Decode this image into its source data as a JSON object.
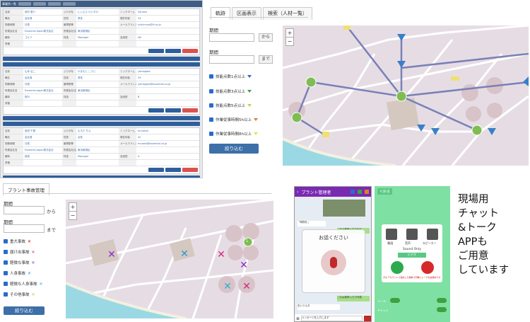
{
  "top_left": {
    "header": "事業所一覧",
    "cards": [
      {
        "rows": [
          [
            "名前",
            "西村 恵介",
            "ふりがな",
            "にしむら けいすけ",
            "ニックネーム",
            "Sanaza"
          ],
          [
            "職名",
            "会社員",
            "性別",
            "男性",
            "現在年齢",
            "34"
          ],
          [
            "勤務時間",
            "日勤",
            "最寄駅等",
            "",
            "メールアドレス",
            "nishimura@fr.co.jp"
          ],
          [
            "所属会社名",
            "Essential Japan株式会社",
            "所属会社住所",
            "東京都港区",
            "",
            ""
          ],
          [
            "趣味",
            "ゴルフ",
            "特技",
            "Manager",
            "血液型",
            "AB"
          ],
          [
            "資格",
            "",
            "",
            "",
            "",
            ""
          ]
        ]
      },
      {
        "rows": [
          [
            "名前",
            "山本 弘二",
            "ふりがな",
            "やまもと こうじ",
            "ニックネーム",
            "yamagata"
          ],
          [
            "職名",
            "会社員",
            "性別",
            "男性",
            "現在年齢",
            "39"
          ],
          [
            "勤務時間",
            "日勤",
            "最寄駅等",
            "",
            "メールアドレス",
            "yamagata@essential.co.jp"
          ],
          [
            "所属会社名",
            "Essential Japan株式会社",
            "所属会社住所",
            "東京都港区",
            "",
            ""
          ],
          [
            "趣味",
            "旅行",
            "特技",
            "",
            "血液型",
            "B"
          ],
          [
            "資格",
            "",
            "",
            "",
            "",
            ""
          ]
        ]
      },
      {
        "rows": [
          [
            "名前",
            "室田 千恵",
            "ふりがな",
            "むろた ちえ",
            "ニックネーム",
            "murotae"
          ],
          [
            "職名",
            "会社員",
            "性別",
            "女性",
            "現在年齢",
            "42"
          ],
          [
            "勤務時間",
            "日勤",
            "最寄駅等",
            "",
            "メールアドレス",
            "murota@essential.co.jp"
          ],
          [
            "所属会社名",
            "Essential Japan株式会社",
            "所属会社住所",
            "東京都港区",
            "",
            ""
          ],
          [
            "趣味",
            "読書",
            "特技",
            "Manager",
            "血液型",
            "A"
          ],
          [
            "資格",
            "",
            "",
            "",
            "",
            ""
          ]
        ]
      }
    ]
  },
  "top_right": {
    "tabs": [
      "軌跡",
      "区画表示",
      "検索（人材一覧）"
    ],
    "period_label": "期間",
    "from_suffix": "から",
    "to_suffix": "まで",
    "filters": [
      {
        "label": "技能点数1点以上",
        "color": "#2a6ad0"
      },
      {
        "label": "技能点数3点以上",
        "color": "#3fa03f"
      },
      {
        "label": "技能点数5点以上",
        "color": "#c8d43a"
      },
      {
        "label": "作業従事時間5h以上",
        "color": "#e07b2a"
      },
      {
        "label": "作業従事時間8h以上",
        "color": "#e8e23a"
      }
    ],
    "submit": "絞り込む",
    "markers": [
      "14",
      "2",
      "2",
      "2",
      "3",
      "1",
      "14"
    ],
    "zoom": [
      "+",
      "−"
    ]
  },
  "bottom_left": {
    "tab": "プラント事故管理",
    "period_label": "期間",
    "from_suffix": "から",
    "to_suffix": "まで",
    "filters": [
      "重大事故",
      "届け出事故",
      "軽微な事故",
      "人身事故",
      "軽微な人身事故",
      "その他事故"
    ],
    "submit": "絞り込む",
    "marker": "1",
    "zoom": [
      "+",
      "−"
    ]
  },
  "phone_chat": {
    "title": "プラント管理者",
    "voice_prompt": "お話ください",
    "chat_lines": [
      "「荷物を」",
      "これは音声入力された",
      "これは音声入力で作成",
      "あいうえお"
    ],
    "input_placeholder": "メッセージを入力します"
  },
  "phone_call": {
    "back": "＜戻る",
    "options": [
      "動画",
      "音声",
      "スピーカー"
    ],
    "sound_only": "Sound Only",
    "toggle_label": "ビデオ",
    "warning": "同じアカウントで接続した端末で同時にトークを実施中です",
    "bottom_labels": [
      "メール",
      "チャット"
    ]
  },
  "caption": [
    "現場用",
    "チャット",
    "&トーク",
    "APPも",
    "ご用意",
    "しています"
  ]
}
